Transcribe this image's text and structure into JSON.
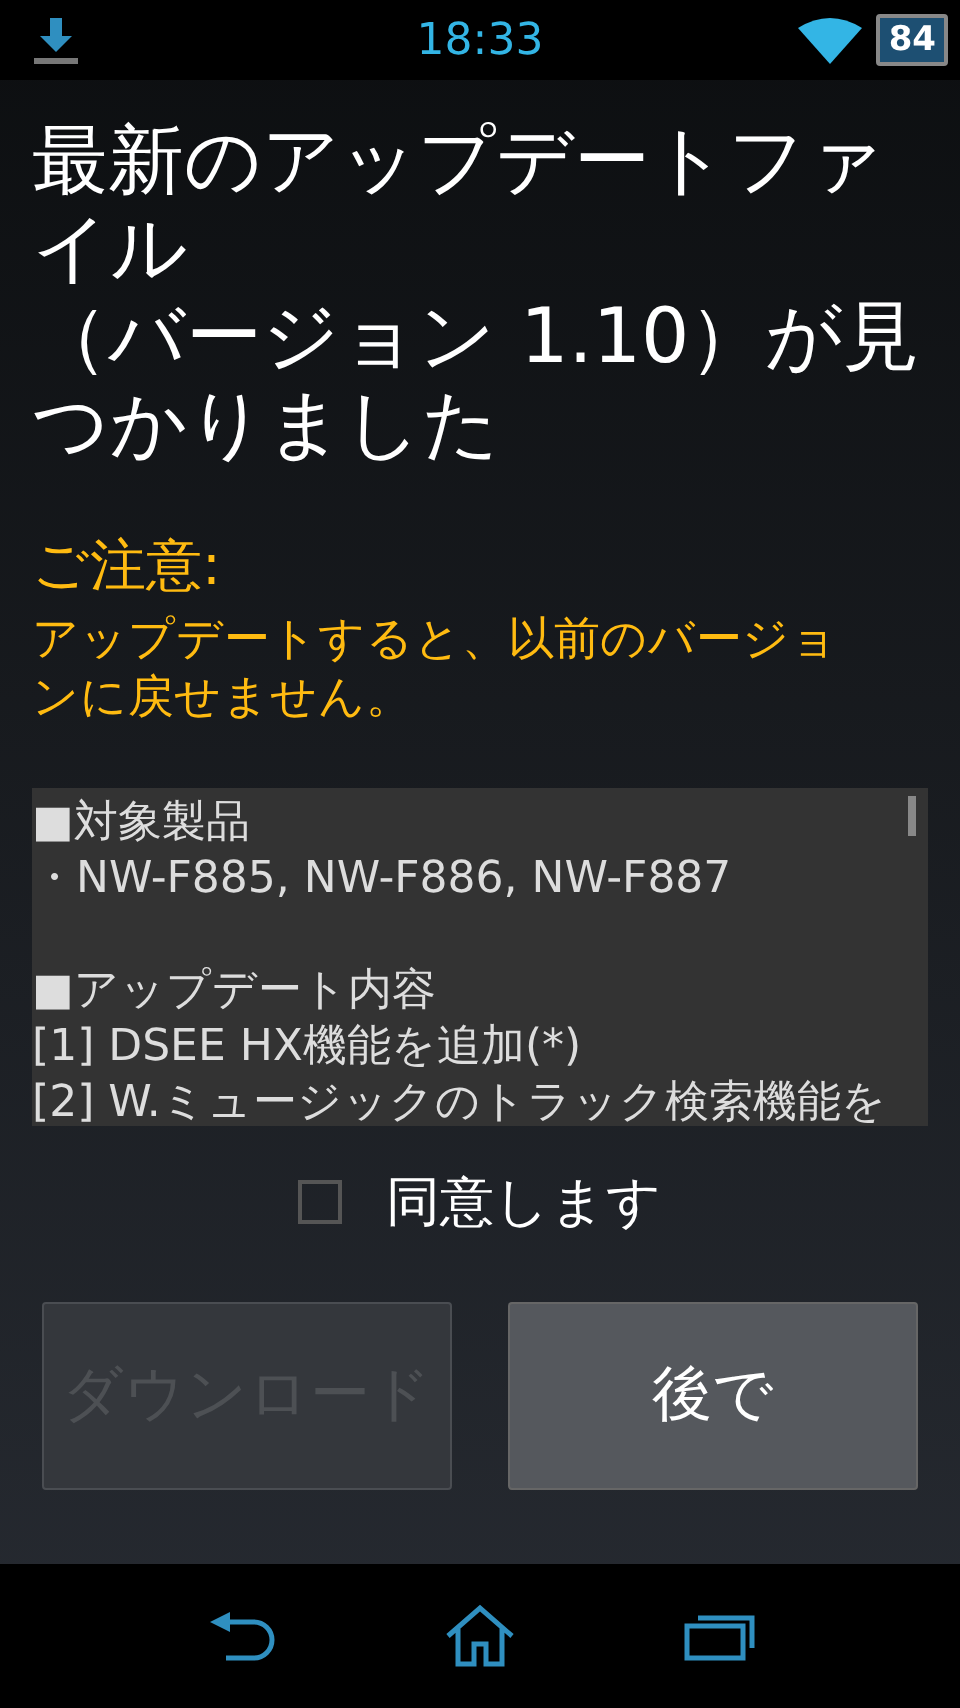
{
  "status_bar": {
    "time": "18:33",
    "battery": "84"
  },
  "title": [
    "最新のアップデートファイル",
    "（バージョン 1.10）が見つかりました"
  ],
  "notice": {
    "heading": "ご注意:",
    "text": "アップデートすると、以前のバージョンに戻せません。"
  },
  "details": [
    {
      "heading": "■対象製品",
      "lines": [
        "・NW-F885, NW-F886, NW-F887"
      ]
    },
    {
      "heading": "■アップデート内容",
      "lines": [
        "[1] DSEE HX機能を追加(*)",
        "[2] W.ミュージックのトラック検索機能を"
      ]
    }
  ],
  "agree": {
    "label": "同意します",
    "checked": false
  },
  "buttons": [
    {
      "label": "ダウンロード",
      "disabled": true
    },
    {
      "label": "後で",
      "disabled": false
    }
  ]
}
